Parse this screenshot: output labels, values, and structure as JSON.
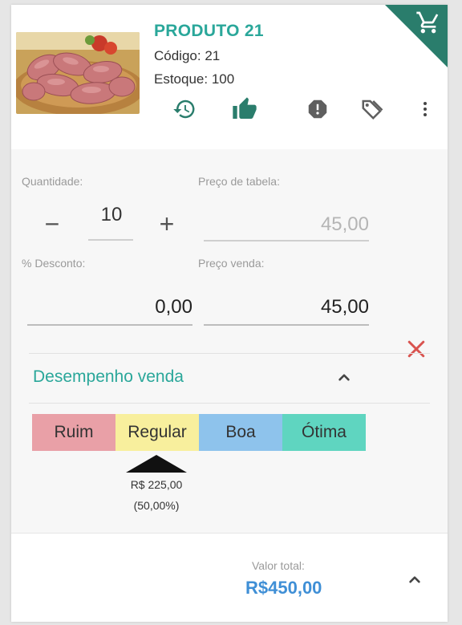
{
  "product": {
    "title": "PRODUTO 21",
    "code": "Código: 21",
    "stock": "Estoque: 100",
    "image_desc": "sausages on a wooden board"
  },
  "actions": [
    {
      "icon": "history-icon"
    },
    {
      "icon": "thumbs-up-icon"
    },
    {
      "icon": "alert-icon"
    },
    {
      "icon": "tags-icon"
    },
    {
      "icon": "more-vertical-icon"
    }
  ],
  "form": {
    "quantity_label": "Quantidade:",
    "quantity_value": "10",
    "minus": "−",
    "plus": "+",
    "table_price_label": "Preço de tabela:",
    "table_price_value": "45,00",
    "discount_label": "% Desconto:",
    "discount_value": "0,00",
    "sale_price_label": "Preço venda:",
    "sale_price_value": "45,00"
  },
  "performance": {
    "title": "Desempenho venda",
    "levels": [
      {
        "label": "Ruim",
        "color": "#e9a0a7"
      },
      {
        "label": "Regular",
        "color": "#f8ef9d"
      },
      {
        "label": "Boa",
        "color": "#8ec3ec"
      },
      {
        "label": "Ótima",
        "color": "#5fd5c0"
      }
    ],
    "marker_value": "R$ 225,00",
    "marker_percent": "(50,00%)"
  },
  "footer": {
    "total_label": "Valor total:",
    "total_value": "R$450,00"
  },
  "colors": {
    "accent_teal": "#2aa79a",
    "corner_green": "#2a7d6c",
    "total_blue": "#3f8fd6",
    "delete_red": "#d9534f"
  }
}
